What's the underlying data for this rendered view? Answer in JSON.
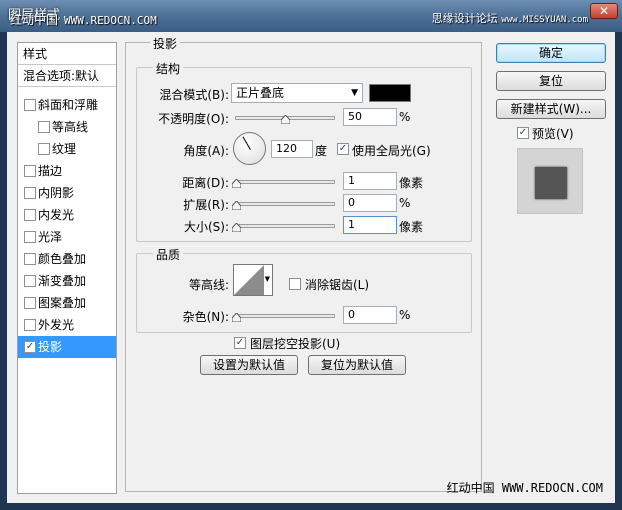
{
  "window": {
    "title": "图层样式",
    "watermark_top": "红动中国",
    "watermark_top_url": "WWW.REDOCN.COM",
    "watermark_right": "思缘设计论坛",
    "watermark_right_url": "www.MISSYUAN.com",
    "close_glyph": "✕"
  },
  "sidebar": {
    "header_styles": "样式",
    "header_blend": "混合选项:默认",
    "items": [
      {
        "label": "斜面和浮雕",
        "checked": false
      },
      {
        "label": "等高线",
        "checked": false,
        "sub": true
      },
      {
        "label": "纹理",
        "checked": false,
        "sub": true
      },
      {
        "label": "描边",
        "checked": false
      },
      {
        "label": "内阴影",
        "checked": false
      },
      {
        "label": "内发光",
        "checked": false
      },
      {
        "label": "光泽",
        "checked": false
      },
      {
        "label": "颜色叠加",
        "checked": false
      },
      {
        "label": "渐变叠加",
        "checked": false
      },
      {
        "label": "图案叠加",
        "checked": false
      },
      {
        "label": "外发光",
        "checked": false
      },
      {
        "label": "投影",
        "checked": true,
        "selected": true
      }
    ]
  },
  "panel": {
    "title": "投影",
    "structure": {
      "title": "结构",
      "blend_mode_label": "混合模式(B):",
      "blend_mode_value": "正片叠底",
      "blend_color": "#000000",
      "opacity_label": "不透明度(O):",
      "opacity_value": "50",
      "opacity_unit": "%",
      "opacity_level": 50,
      "angle_label": "角度(A):",
      "angle_value": "120",
      "angle_unit": "度",
      "global_light_label": "使用全局光(G)",
      "global_light_checked": true,
      "distance_label": "距离(D):",
      "distance_value": "1",
      "distance_unit": "像素",
      "spread_label": "扩展(R):",
      "spread_value": "0",
      "spread_unit": "%",
      "size_label": "大小(S):",
      "size_value": "1",
      "size_unit": "像素"
    },
    "quality": {
      "title": "品质",
      "contour_label": "等高线:",
      "antialias_label": "消除锯齿(L)",
      "antialias_checked": false,
      "noise_label": "杂色(N):",
      "noise_value": "0",
      "noise_unit": "%"
    },
    "knockout_label": "图层挖空投影(U)",
    "knockout_checked": true,
    "set_default_label": "设置为默认值",
    "reset_default_label": "复位为默认值"
  },
  "buttons": {
    "ok": "确定",
    "reset": "复位",
    "new_style": "新建样式(W)...",
    "preview_label": "预览(V)",
    "preview_checked": true
  },
  "footer": {
    "watermark": "红动中国",
    "watermark_url": "WWW.REDOCN.COM"
  },
  "icons": {
    "checkmark": "✓",
    "dropdown": "▼"
  }
}
